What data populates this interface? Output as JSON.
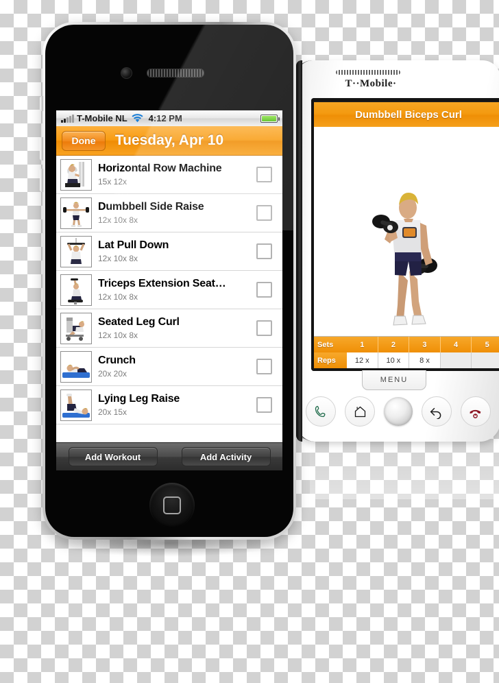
{
  "iphone": {
    "status_bar": {
      "carrier": "T-Mobile NL",
      "time": "4:12 PM",
      "wifi_icon": "wifi-icon",
      "signal_icon": "signal-bars-icon",
      "battery_icon": "battery-icon"
    },
    "nav": {
      "done_label": "Done",
      "title": "Tuesday, Apr 10"
    },
    "rows": [
      {
        "title": "Horizontal Row Machine",
        "sets": "15x 12x",
        "thumb": "row-machine-thumb",
        "checked": false
      },
      {
        "title": "Dumbbell Side Raise",
        "sets": "12x 10x 8x",
        "thumb": "side-raise-thumb",
        "checked": false
      },
      {
        "title": "Lat Pull Down",
        "sets": "12x 10x 8x",
        "thumb": "lat-pulldown-thumb",
        "checked": false
      },
      {
        "title": "Triceps Extension Seat…",
        "sets": "12x 10x 8x",
        "thumb": "triceps-extension-thumb",
        "checked": false
      },
      {
        "title": "Seated Leg Curl",
        "sets": "12x 10x 8x",
        "thumb": "leg-curl-thumb",
        "checked": false
      },
      {
        "title": "Crunch",
        "sets": "20x 20x",
        "thumb": "crunch-thumb",
        "checked": false
      },
      {
        "title": "Lying Leg Raise",
        "sets": "20x 15x",
        "thumb": "leg-raise-thumb",
        "checked": false
      }
    ],
    "toolbar": {
      "add_workout_label": "Add Workout",
      "add_activity_label": "Add Activity"
    }
  },
  "android": {
    "brand": "T··Mobile·",
    "title": "Dumbbell Biceps Curl",
    "exercise_image": "dumbbell-biceps-curl-figure",
    "table": {
      "sets_label": "Sets",
      "reps_label": "Reps",
      "sets": [
        "1",
        "2",
        "3",
        "4",
        "5"
      ],
      "reps": [
        "12 x",
        "10 x",
        "8 x",
        "",
        ""
      ]
    },
    "menu_label": "MENU",
    "keys": [
      "call-key",
      "home-key",
      "trackball-key",
      "back-key",
      "end-call-key"
    ]
  },
  "colors": {
    "accent_orange": "#f89c13",
    "nav_orange_dark": "#ef8c04",
    "battery_green": "#4fbe16",
    "toolbar_dark": "#3a3a3a",
    "subtitle_gray": "#7c7c7c"
  }
}
